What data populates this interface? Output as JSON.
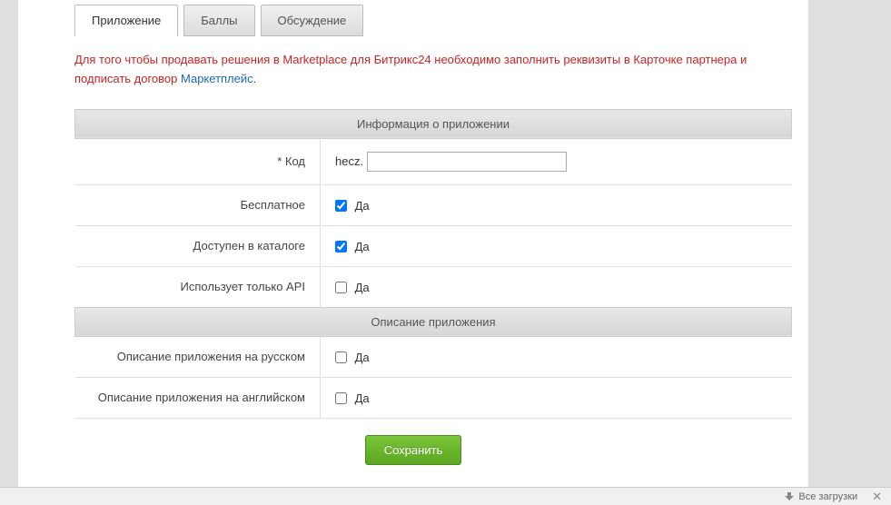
{
  "tabs": [
    {
      "label": "Приложение",
      "active": true
    },
    {
      "label": "Баллы",
      "active": false
    },
    {
      "label": "Обсуждение",
      "active": false
    }
  ],
  "notice": {
    "text_before": "Для того чтобы продавать решения в Marketplace для Битрикс24 необходимо заполнить реквизиты в Карточке партнера и подписать договор ",
    "link_text": "Маркетплейс",
    "text_after": "."
  },
  "sections": {
    "app_info": "Информация о приложении",
    "app_desc": "Описание приложения"
  },
  "fields": {
    "code": {
      "label": "* Код",
      "prefix": "hecz.",
      "value": ""
    },
    "free": {
      "label": "Бесплатное",
      "checkbox_label": "Да",
      "checked": true
    },
    "catalog": {
      "label": "Доступен в каталоге",
      "checkbox_label": "Да",
      "checked": true
    },
    "api_only": {
      "label": "Использует только API",
      "checkbox_label": "Да",
      "checked": false
    },
    "desc_ru": {
      "label": "Описание приложения на русском",
      "checkbox_label": "Да",
      "checked": false
    },
    "desc_en": {
      "label": "Описание приложения на английском",
      "checkbox_label": "Да",
      "checked": false
    }
  },
  "buttons": {
    "save": "Сохранить"
  },
  "bottom_bar": {
    "downloads": "Все загрузки"
  }
}
